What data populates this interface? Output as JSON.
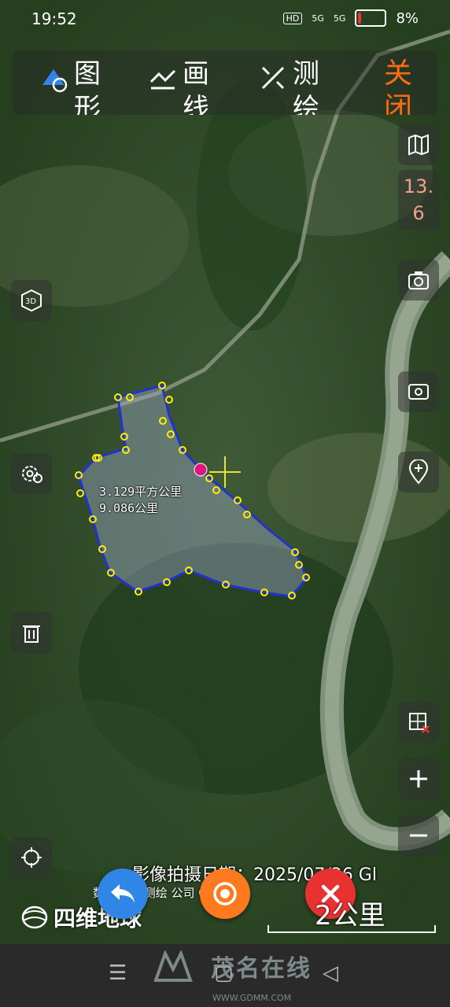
{
  "status_bar": {
    "time": "19:52",
    "hd_label": "HD",
    "sig1": "5G",
    "sig2": "5G",
    "battery": "8%"
  },
  "toolbar": {
    "shape_label": "图形",
    "line_label": "画线",
    "survey_label": "测绘",
    "close_label": "关闭"
  },
  "map": {
    "zoom_level": "13.6",
    "area_text": "3.129平方公里",
    "length_text": "9.086公里",
    "imagery_date": "影像拍摄日期：2025/07/26 Gl",
    "copyright": "数    国四维测绘     公司 GS(20",
    "brand": "四维地球",
    "scale_label": "2公里"
  },
  "watermark": {
    "text": "茂名在线",
    "url": "WWW.GDMM.COM"
  },
  "colors": {
    "accent_orange": "#ff6a13",
    "zoom_text": "#f2a08a",
    "polygon_stroke": "#2233cc",
    "vertex": "#ffee00",
    "back_button": "#2f86e6",
    "locate_button": "#ff7a1f",
    "cancel_button": "#e83232"
  }
}
